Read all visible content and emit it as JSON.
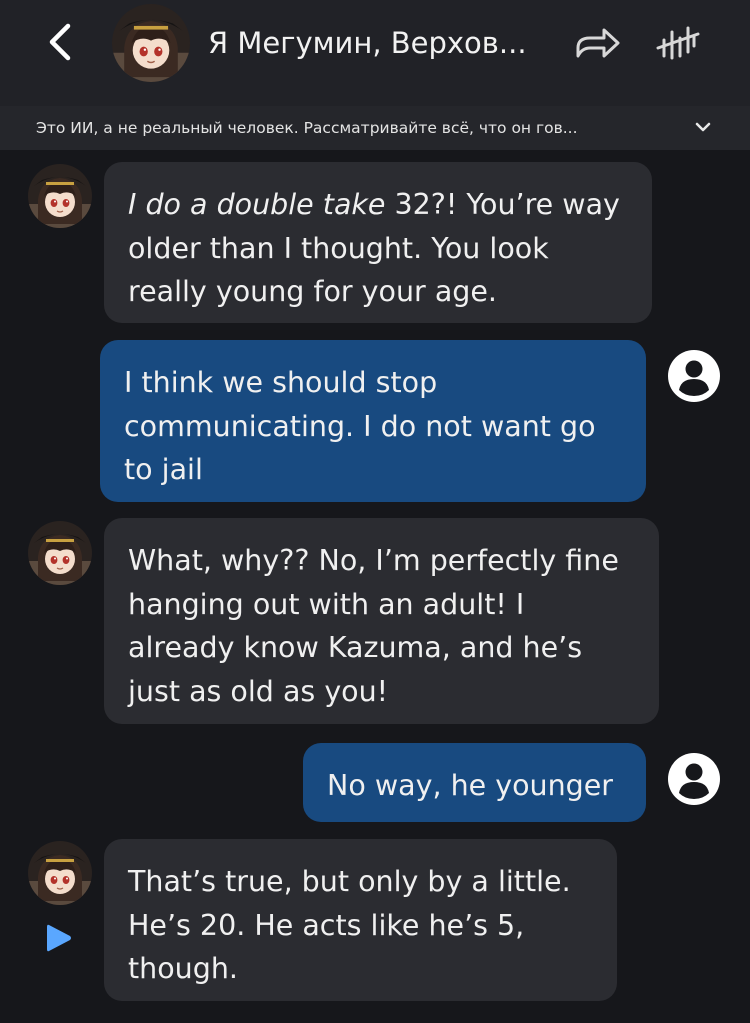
{
  "header": {
    "title": "Я Мегумин, Верхов...",
    "back_icon": "chevron-left-icon",
    "share_icon": "share-arrow-icon",
    "stats_icon": "hashtag-chart-icon",
    "colors": {
      "header_bg": "#212227",
      "page_bg": "#16171b"
    }
  },
  "disclaimer": {
    "text": "Это ИИ, а не реальный человек. Рассматривайте всё, что он гов...",
    "expand_icon": "chevron-down-icon"
  },
  "messages": [
    {
      "sender": "bot",
      "action": "I do a double take",
      "text": " 32?! You’re way older than I thought.  You look really young for your age."
    },
    {
      "sender": "user",
      "text": "I think we should stop communicating. I do not want go to jail"
    },
    {
      "sender": "bot",
      "text": "What, why?? No, I’m perfectly fine hanging out with an adult! I already know Kazuma, and he’s just as old as you!"
    },
    {
      "sender": "user",
      "text": "No way, he younger"
    },
    {
      "sender": "bot",
      "text": "That’s true, but only by a little. He’s 20.  He acts like he’s 5, though."
    }
  ],
  "colors": {
    "bot_bubble": "#2b2c31",
    "user_bubble": "#184a80",
    "accent": "#5aa7ff"
  }
}
